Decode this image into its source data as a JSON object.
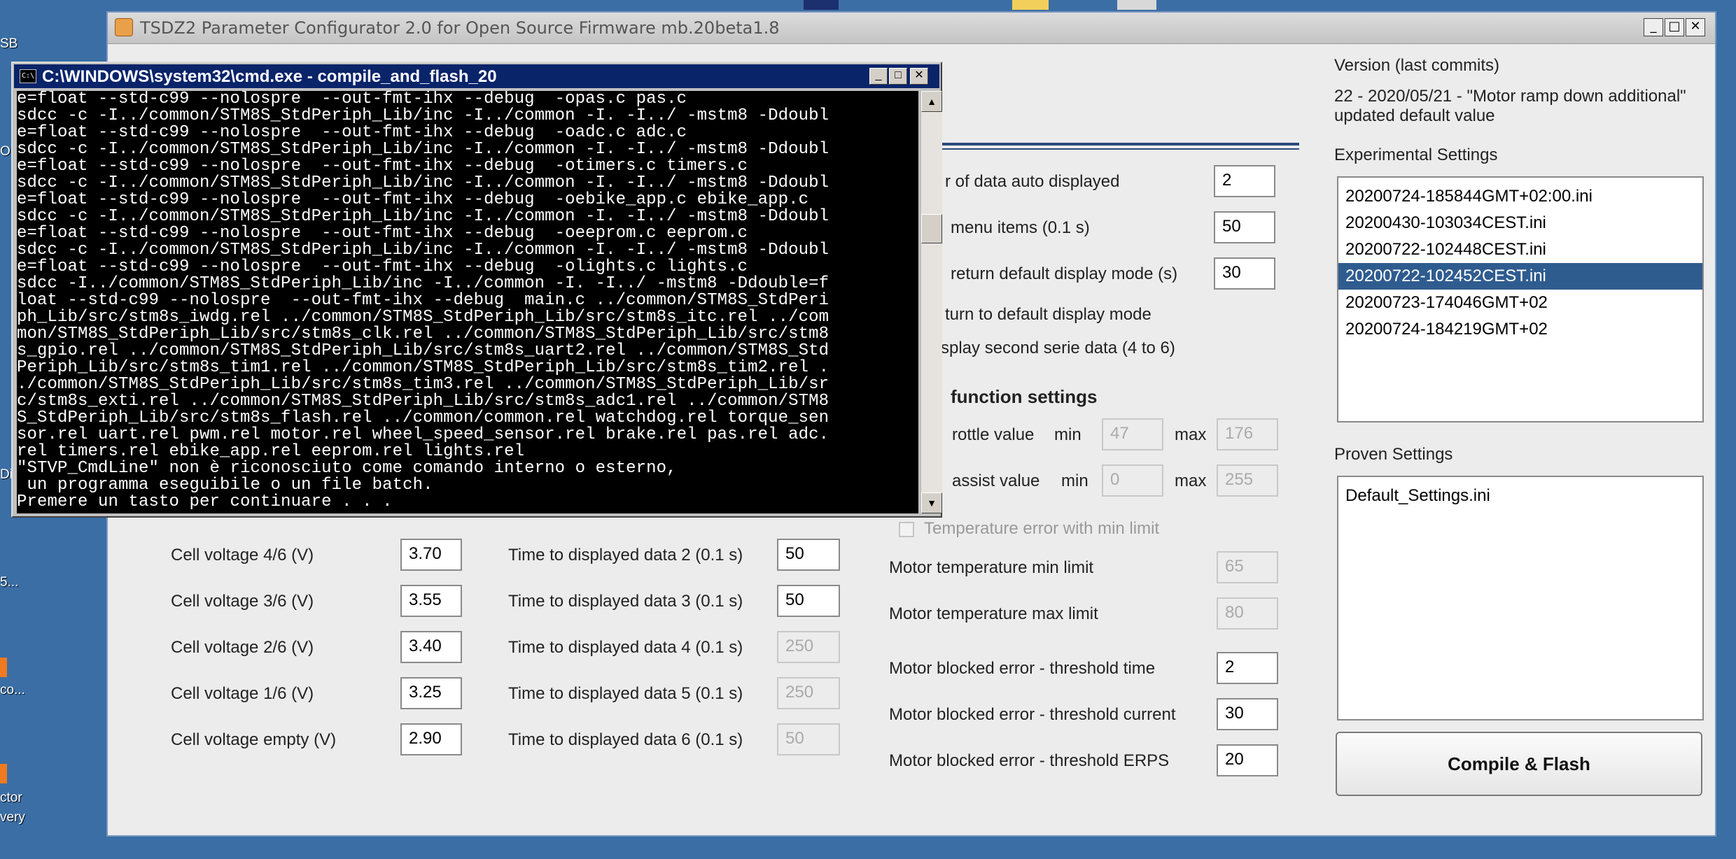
{
  "desktop": {
    "labels": [
      "SB",
      "O",
      "Di",
      "5...",
      "co...",
      "ctor",
      "very"
    ]
  },
  "main_window": {
    "title": "TSDZ2 Parameter Configurator 2.0 for Open Source Firmware mb.20beta1.8",
    "controls": {
      "minimize": "_",
      "maximize": "□",
      "close": "✕"
    },
    "right_panel": {
      "version_heading": "Version (last commits)",
      "version_text_1": "22 - 2020/05/21 - \"Motor ramp down additional\"",
      "version_text_2": "updated default value",
      "experimental_heading": "Experimental Settings",
      "experimental_items": [
        "20200724-185844GMT+02:00.ini",
        "20200430-103034CEST.ini",
        "20200722-102448CEST.ini",
        "20200722-102452CEST.ini",
        "20200723-174046GMT+02",
        "20200724-184219GMT+02"
      ],
      "experimental_selected_index": 3,
      "proven_heading": "Proven Settings",
      "proven_items": [
        "Default_Settings.ini"
      ],
      "compile_button": "Compile & Flash"
    },
    "display_settings": {
      "data_auto_label": "r of data auto displayed",
      "data_auto_value": "2",
      "menu_items_label": "menu items (0.1 s)",
      "menu_items_value": "50",
      "return_default_label": "return default display mode (s)",
      "return_default_value": "30",
      "turn_default_label": "turn to default display mode",
      "second_serie_label": "splay second serie data (4 to 6)"
    },
    "function_settings": {
      "heading": "function settings",
      "throttle_label": "rottle value",
      "throttle_min_label": "min",
      "throttle_min": "47",
      "throttle_max_label": "max",
      "throttle_max": "176",
      "assist_label": "assist value",
      "assist_min_label": "min",
      "assist_min": "0",
      "assist_max_label": "max",
      "assist_max": "255",
      "temp_error_label": "Temperature error with min limit",
      "motor_temp_min_label": "Motor temperature min limit",
      "motor_temp_min": "65",
      "motor_temp_max_label": "Motor temperature max limit",
      "motor_temp_max": "80",
      "blocked_time_label": "Motor blocked error - threshold time",
      "blocked_time": "2",
      "blocked_current_label": "Motor blocked error - threshold current",
      "blocked_current": "30",
      "blocked_erps_label": "Motor blocked error - threshold ERPS",
      "blocked_erps": "20"
    },
    "cell_voltages": [
      {
        "label": "Cell voltage 4/6 (V)",
        "value": "3.70"
      },
      {
        "label": "Cell voltage 3/6 (V)",
        "value": "3.55"
      },
      {
        "label": "Cell voltage 2/6 (V)",
        "value": "3.40"
      },
      {
        "label": "Cell voltage 1/6 (V)",
        "value": "3.25"
      },
      {
        "label": "Cell voltage empty (V)",
        "value": "2.90"
      }
    ],
    "display_times": [
      {
        "label": "Time to displayed data 2 (0.1 s)",
        "value": "50"
      },
      {
        "label": "Time to displayed data 3 (0.1 s)",
        "value": "50"
      },
      {
        "label": "Time to displayed data 4 (0.1 s)",
        "value": "250"
      },
      {
        "label": "Time to displayed data 5 (0.1 s)",
        "value": "250"
      },
      {
        "label": "Time to displayed data 6 (0.1 s)",
        "value": "50"
      }
    ]
  },
  "cmd_window": {
    "title": "C:\\WINDOWS\\system32\\cmd.exe - compile_and_flash_20",
    "lines": [
      "e=float --std-c99 --nolospre  --out-fmt-ihx --debug  -opas.c pas.c",
      "sdcc -c -I../common/STM8S_StdPeriph_Lib/inc -I../common -I. -I../ -mstm8 -Ddoubl",
      "e=float --std-c99 --nolospre  --out-fmt-ihx --debug  -oadc.c adc.c",
      "sdcc -c -I../common/STM8S_StdPeriph_Lib/inc -I../common -I. -I../ -mstm8 -Ddoubl",
      "e=float --std-c99 --nolospre  --out-fmt-ihx --debug  -otimers.c timers.c",
      "sdcc -c -I../common/STM8S_StdPeriph_Lib/inc -I../common -I. -I../ -mstm8 -Ddoubl",
      "e=float --std-c99 --nolospre  --out-fmt-ihx --debug  -oebike_app.c ebike_app.c",
      "sdcc -c -I../common/STM8S_StdPeriph_Lib/inc -I../common -I. -I../ -mstm8 -Ddoubl",
      "e=float --std-c99 --nolospre  --out-fmt-ihx --debug  -oeeprom.c eeprom.c",
      "sdcc -c -I../common/STM8S_StdPeriph_Lib/inc -I../common -I. -I../ -mstm8 -Ddoubl",
      "e=float --std-c99 --nolospre  --out-fmt-ihx --debug  -olights.c lights.c",
      "sdcc -I../common/STM8S_StdPeriph_Lib/inc -I../common -I. -I../ -mstm8 -Ddouble=f",
      "loat --std-c99 --nolospre  --out-fmt-ihx --debug  main.c ../common/STM8S_StdPeri",
      "ph_Lib/src/stm8s_iwdg.rel ../common/STM8S_StdPeriph_Lib/src/stm8s_itc.rel ../com",
      "mon/STM8S_StdPeriph_Lib/src/stm8s_clk.rel ../common/STM8S_StdPeriph_Lib/src/stm8",
      "s_gpio.rel ../common/STM8S_StdPeriph_Lib/src/stm8s_uart2.rel ../common/STM8S_Std",
      "Periph_Lib/src/stm8s_tim1.rel ../common/STM8S_StdPeriph_Lib/src/stm8s_tim2.rel .",
      "./common/STM8S_StdPeriph_Lib/src/stm8s_tim3.rel ../common/STM8S_StdPeriph_Lib/sr",
      "c/stm8s_exti.rel ../common/STM8S_StdPeriph_Lib/src/stm8s_adc1.rel ../common/STM8",
      "S_StdPeriph_Lib/src/stm8s_flash.rel ../common/common.rel watchdog.rel torque_sen",
      "sor.rel uart.rel pwm.rel motor.rel wheel_speed_sensor.rel brake.rel pas.rel adc.",
      "rel timers.rel ebike_app.rel eeprom.rel lights.rel",
      "\"STVP_CmdLine\" non è riconosciuto come comando interno o esterno,",
      " un programma eseguibile o un file batch.",
      "Premere un tasto per continuare . . ."
    ],
    "scroll_up": "▲",
    "scroll_down": "▼"
  }
}
